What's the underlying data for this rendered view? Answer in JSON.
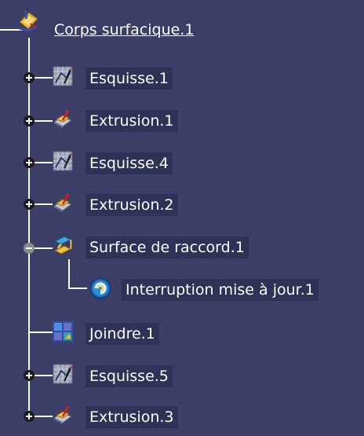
{
  "tree": {
    "root": {
      "label": "Corps surfacique.1",
      "icon": "body-surfacique-icon"
    },
    "items": [
      {
        "label": "Esquisse.1",
        "icon": "sketch-icon",
        "expander": "plus"
      },
      {
        "label": "Extrusion.1",
        "icon": "extrusion-icon",
        "expander": "plus"
      },
      {
        "label": "Esquisse.4",
        "icon": "sketch-icon",
        "expander": "plus"
      },
      {
        "label": "Extrusion.2",
        "icon": "extrusion-icon",
        "expander": "plus"
      },
      {
        "label": "Surface de raccord.1",
        "icon": "blend-surface-icon",
        "expander": "minus",
        "children": [
          {
            "label": "Interruption mise à jour.1",
            "icon": "update-interruption-icon"
          }
        ]
      },
      {
        "label": "Joindre.1",
        "icon": "join-icon",
        "expander": "none"
      },
      {
        "label": "Esquisse.5",
        "icon": "sketch-icon",
        "expander": "plus"
      },
      {
        "label": "Extrusion.3",
        "icon": "extrusion-icon",
        "expander": "plus"
      }
    ]
  },
  "colors": {
    "background": "#3b3e66",
    "label_background": "#2f3257",
    "text": "#ffffff",
    "lines": "#ffffff"
  }
}
